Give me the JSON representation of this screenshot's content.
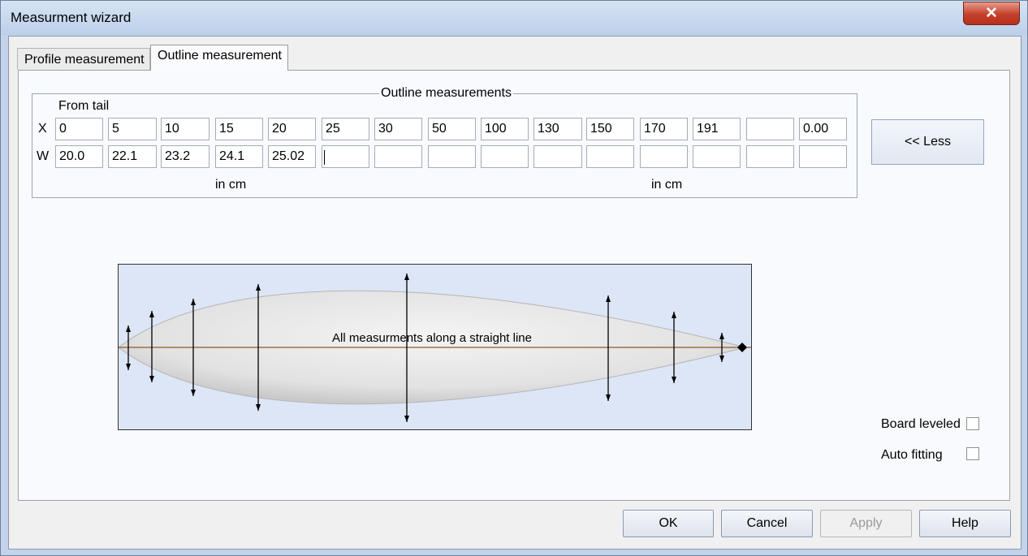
{
  "window": {
    "title": "Measurment wizard",
    "close_label": "✕"
  },
  "tabs": [
    {
      "label": "Profile measurement",
      "active": false
    },
    {
      "label": "Outline measurement",
      "active": true
    }
  ],
  "outline": {
    "group_title": "Outline measurements",
    "from_tail": "From tail",
    "row_x_label": "X",
    "row_w_label": "W",
    "x_values": [
      "0",
      "5",
      "10",
      "15",
      "20",
      "25",
      "30",
      "50",
      "100",
      "130",
      "150",
      "170",
      "191",
      "",
      "0.00"
    ],
    "w_values": [
      "20.0",
      "22.1",
      "23.2",
      "24.1",
      "25.02",
      "",
      "",
      "",
      "",
      "",
      "",
      "",
      "",
      "",
      ""
    ],
    "unit_left": "in cm",
    "unit_right": "in cm"
  },
  "less_button": "<< Less",
  "figure": {
    "caption": "All measurments along a straight line",
    "colors": {
      "background": "#dde6f6",
      "board": "#e8e8e8",
      "centerline": "#8b5a2b"
    }
  },
  "options": {
    "board_leveled": {
      "label": "Board leveled",
      "checked": false
    },
    "auto_fitting": {
      "label": "Auto fitting",
      "checked": false
    }
  },
  "buttons": {
    "ok": "OK",
    "cancel": "Cancel",
    "apply": "Apply",
    "help": "Help"
  }
}
